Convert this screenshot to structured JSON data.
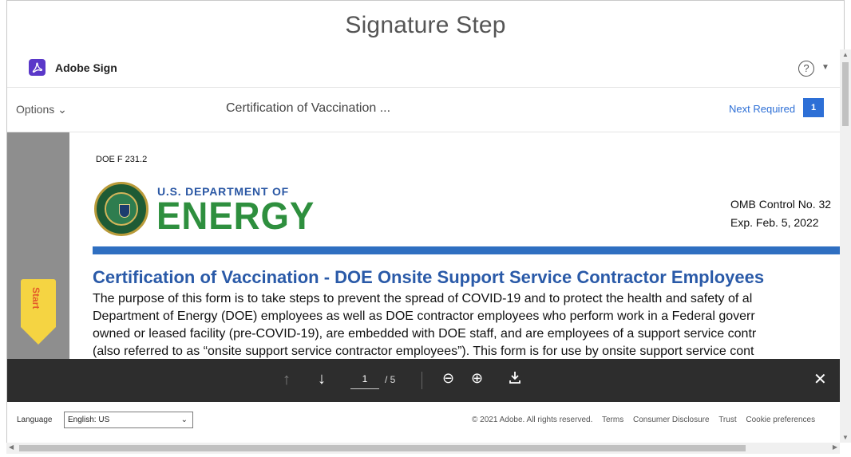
{
  "window": {
    "title": "Signature Step"
  },
  "header": {
    "brand": "Adobe Sign",
    "help_icon": "help-circle-icon"
  },
  "toolbar": {
    "options_label": "Options ⌄",
    "document_title": "Certification of Vaccination ...",
    "next_required_label": "Next Required",
    "next_required_count": "1"
  },
  "document": {
    "form_number": "DOE F 231.2",
    "dept_line": "U.S. DEPARTMENT OF",
    "energy_word": "ENERGY",
    "omb_control": "OMB Control No. 32",
    "expiration": "Exp. Feb. 5, 2022",
    "heading": "Certification of Vaccination - DOE Onsite Support Service Contractor Employees",
    "paragraph_lines": [
      "The purpose of this form is to take steps to prevent the spread of COVID-19 and to protect the health and safety of al",
      "Department of Energy (DOE) employees as well as DOE contractor employees who perform work in a Federal goverr",
      "owned or leased facility (pre-COVID-19), are embedded with DOE staff, and are employees of a support service contr",
      "(also referred to as “onsite support service contractor employees”). This form is for use by onsite support service cont"
    ],
    "start_label": "Start"
  },
  "nav": {
    "current_page": "1",
    "total_pages": "/ 5"
  },
  "footer": {
    "language_label": "Language",
    "language_value": "English: US",
    "copyright": "© 2021 Adobe. All rights reserved.",
    "links": [
      "Terms",
      "Consumer Disclosure",
      "Trust",
      "Cookie preferences"
    ]
  },
  "colors": {
    "accent_blue": "#2d6fd6",
    "adobe_purple": "#5a38c9",
    "start_tab_yellow": "#f5d442",
    "nav_bar": "#2d2d2d",
    "energy_green": "#2e8f3e"
  }
}
